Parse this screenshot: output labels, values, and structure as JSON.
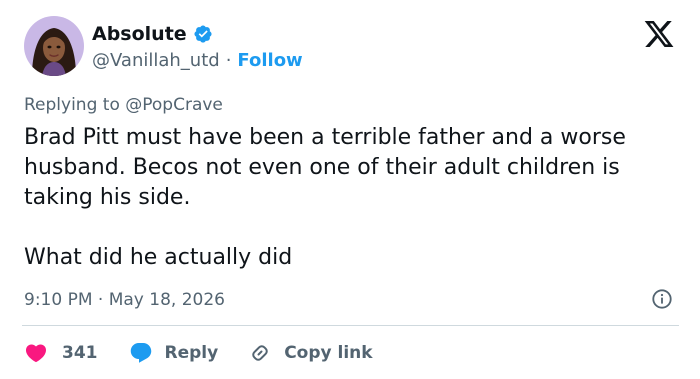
{
  "author": {
    "display_name": "Absolute",
    "handle": "@Vanillah_utd",
    "separator": "·",
    "follow_label": "Follow"
  },
  "reply_context": {
    "prefix": "Replying to",
    "mention": "@PopCrave"
  },
  "tweet": {
    "paragraph_1": "Brad Pitt must have been a terrible father and a worse husband. Becos not even one of their adult children is taking his side.",
    "paragraph_2": "What did he actually did"
  },
  "meta": {
    "timestamp": "9:10 PM · May 18, 2026"
  },
  "actions": {
    "like_count": "341",
    "reply_label": "Reply",
    "copy_link_label": "Copy link"
  },
  "colors": {
    "accent": "#1d9bf0",
    "like": "#f91880",
    "text": "#0f1419",
    "muted": "#536471",
    "divider": "#cfd9de"
  },
  "icons": {
    "verified": "verified-badge-icon",
    "brand": "x-logo-icon",
    "info": "info-icon",
    "like": "heart-icon",
    "reply": "reply-bubble-icon",
    "copy": "link-icon"
  }
}
